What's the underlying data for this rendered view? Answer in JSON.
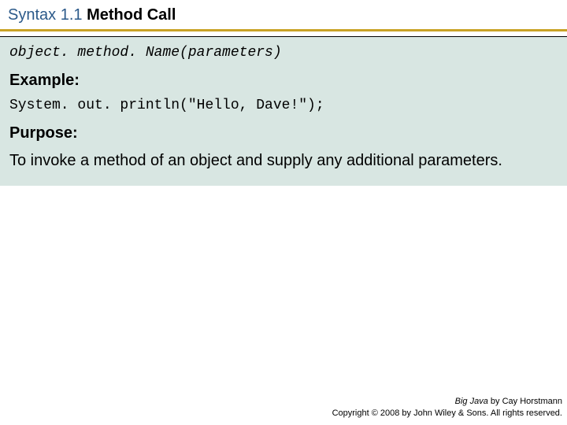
{
  "header": {
    "prefix": "Syntax 1.1",
    "title": "Method Call"
  },
  "content": {
    "syntax": "object. method. Name(parameters)",
    "example_label": "Example:",
    "example_code": "System. out. println(\"Hello, Dave!\");",
    "purpose_label": "Purpose:",
    "purpose_text": "To invoke a method of an object and supply any additional parameters."
  },
  "footer": {
    "book": "Big Java",
    "author": " by Cay Horstmann",
    "copyright": "Copyright © 2008 by John Wiley & Sons. All rights reserved."
  }
}
